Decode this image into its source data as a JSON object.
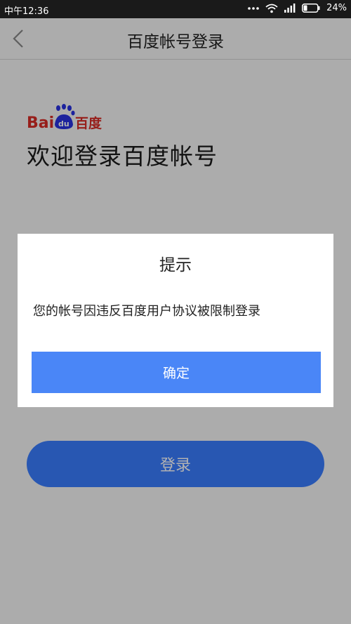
{
  "status_bar": {
    "time": "中午12:36",
    "battery": "24%",
    "icons": [
      "more-dots-icon",
      "wifi-icon",
      "signal-icon",
      "battery-icon"
    ]
  },
  "nav": {
    "title": "百度帐号登录",
    "back_icon": "chevron-left-icon"
  },
  "logo": {
    "text_latin": "Bai",
    "text_paw": "du",
    "text_cn": "百度",
    "colors": {
      "red": "#d92c26",
      "blue": "#2932e1"
    }
  },
  "welcome": "欢迎登录百度帐号",
  "login_button": "登录",
  "dialog": {
    "title": "提示",
    "message": "您的帐号因违反百度用户协议被限制登录",
    "confirm": "确定"
  },
  "colors": {
    "accent": "#4a86f7",
    "login_button": "#3a7dff",
    "status_bar": "#1a1a1a"
  }
}
